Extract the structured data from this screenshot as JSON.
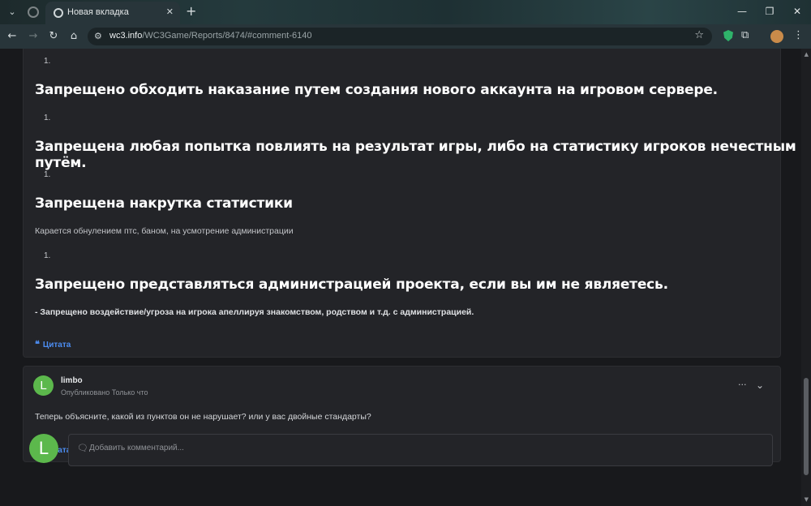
{
  "browser": {
    "tab_title": "Новая вкладка",
    "tab_close": "✕",
    "new_tab": "+",
    "url_host": "wc3.info",
    "url_path": "/WC3Game/Reports/8474/#comment-6140",
    "win_minimize": "—",
    "win_maximize": "❐",
    "win_close": "✕"
  },
  "post": {
    "items": [
      {
        "marker": "1.",
        "rule": "Запрещено обходить наказание путем создания нового аккаунта на игровом сервере."
      },
      {
        "marker": "1.",
        "rule": "Запрещена любая попытка повлиять на результат игры, либо на статистику игроков нечестным путём."
      },
      {
        "marker": "1.",
        "rule": "Запрещена накрутка статистики",
        "note": "Карается обнулением птс, баном, на усмотрение администрации"
      },
      {
        "marker": "1.",
        "rule": "Запрещено представляться администрацией проекта, если вы им не являетесь.",
        "bold_note": "- Запрещено воздействие/угроза на игрока апеллируя знакомством, родством и т.д. с администрацией."
      }
    ],
    "top_marker": "1.",
    "quote_label": "Цитата"
  },
  "comment": {
    "avatar_letter": "L",
    "author": "limbo",
    "meta": "Опубликовано Только что",
    "text": "Теперь объясните, какой из пунктов он не нарушает? или у вас двойные стандарты?",
    "quote_label": "Цитата"
  },
  "reply": {
    "avatar_letter": "L",
    "placeholder": "Добавить комментарий..."
  },
  "icons": {
    "back": "arrow-left-icon",
    "forward": "arrow-right-icon",
    "reload": "reload-icon",
    "home": "home-icon",
    "star": "star-icon",
    "quote": "quote-icon"
  }
}
